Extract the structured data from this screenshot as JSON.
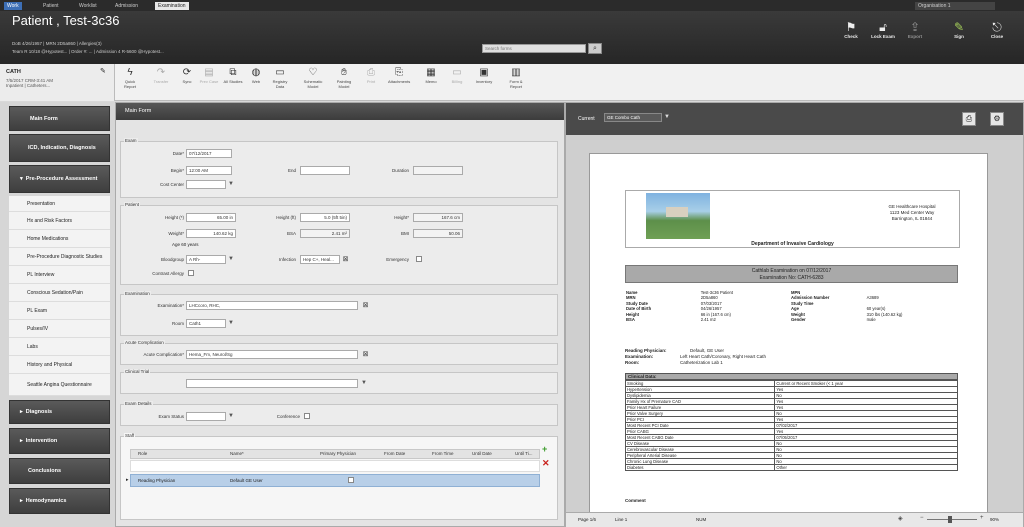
{
  "tabs": [
    "Work",
    "Patient",
    "Worklist",
    "Admission",
    "Examination"
  ],
  "topbar_right": "Organisation 1",
  "patient": {
    "name": "Patient , Test-3c36",
    "line1": "DoB 4/26/1957 | MRN 2D5a860 | Allergies(3)",
    "line2": "Team R 10/18 @Hypotest... | Order #: ... | Admission 4 R-5600 @Hypotest...",
    "allergy_label": "Allergies(3)"
  },
  "search": {
    "placeholder": "Search forms"
  },
  "header_buttons": [
    {
      "icon": "flag-icon",
      "label": "Check"
    },
    {
      "icon": "lock-icon",
      "label": "Lock Exam"
    },
    {
      "icon": "export-icon",
      "label": "Export"
    },
    {
      "icon": "pen-icon",
      "label": "Sign"
    },
    {
      "icon": "close-icon",
      "label": "Close"
    }
  ],
  "cath": {
    "title": "CATH",
    "line1": "7/5/2017 CRM-3:41 AM",
    "line2": "Inpatient | Catheters..."
  },
  "toolbar": [
    {
      "icon": "lightning-icon",
      "label": "Quick Report",
      "disabled": false
    },
    {
      "icon": "forward-icon",
      "label": "Transfer",
      "disabled": true
    },
    {
      "icon": "sync-icon",
      "label": "Sync",
      "disabled": false
    },
    {
      "icon": "preview-icon",
      "label": "Prev Case",
      "disabled": true
    },
    {
      "icon": "studies-icon",
      "label": "All Studies",
      "disabled": false
    },
    {
      "icon": "web-icon",
      "label": "Web",
      "disabled": false
    },
    {
      "icon": "registry-icon",
      "label": "Registry Data",
      "disabled": false
    },
    {
      "icon": "heart-icon",
      "label": "Schematic Model",
      "disabled": false
    },
    {
      "icon": "hand-icon",
      "label": "Painting Model",
      "disabled": false
    },
    {
      "icon": "print-icon",
      "label": "Print",
      "disabled": true
    },
    {
      "icon": "attachment-icon",
      "label": "Attachments",
      "disabled": false
    },
    {
      "icon": "memo-icon",
      "label": "Memo",
      "disabled": false
    },
    {
      "icon": "billing-icon",
      "label": "Billing",
      "disabled": true
    },
    {
      "icon": "inventory-icon",
      "label": "Inventory",
      "disabled": false
    },
    {
      "icon": "report-icon",
      "label": "Form & Report",
      "disabled": false
    }
  ],
  "sidebar": {
    "main_form": "Main Form",
    "icd": "ICD, Indication, Diagnosis",
    "pre": "Pre-Procedure Assessment",
    "sub": [
      "Presentation",
      "Hx and Risk Factors",
      "Home Medications",
      "Pre-Procedure Diagnostic Studies",
      "PL Interview",
      "Conscious Sedation/Pain",
      "PL Exam",
      "Pulses/IV",
      "Labs",
      "History and Physical",
      "Seattle Angina Questionnaire"
    ],
    "diagnosis": "Diagnosis",
    "intervention": "Intervention",
    "conclusions": "Conclusions",
    "hemodynamics": "Hemodynamics"
  },
  "main": {
    "title": "Main Form",
    "exam": {
      "legend": "Exam",
      "date_label": "Date*",
      "date": "07/12/2017",
      "begin_label": "Begin*",
      "begin": "12:00 AM",
      "end_label": "End",
      "duration_label": "Duration",
      "cost_label": "Cost Center"
    },
    "patient": {
      "legend": "Patient",
      "height_cm_label": "Height (*)",
      "height_cm": "65.00 in",
      "height_ft_label": "Height (ft)",
      "height_ft": "5.0 (5ft 5in)",
      "height_label": "Height*",
      "height": "167.6 cm",
      "weight_label": "Weight*",
      "weight": "140.62 kg",
      "bsa_label": "BSA",
      "bsa": "2.41 m²",
      "bmi_label": "BMI",
      "bmi": "50.06",
      "age": "Age 60 years",
      "blood_label": "Bloodgroup",
      "blood": "A Rh-",
      "infection_label": "Infection",
      "infection": "Hep C+, Heal...",
      "emergency_label": "Emergency",
      "contrast_label": "Contrast Allergy"
    },
    "examination": {
      "legend": "Examination",
      "exam_label": "Examination*",
      "exam": "LHCcoro, RHC,",
      "room_label": "Room",
      "room": "Cath1"
    },
    "acute": {
      "legend": "Acute Complication",
      "label": "Acute Complication*",
      "value": "Hema_Fm, Neurol/Sg"
    },
    "clinical": {
      "legend": "Clinical Trial"
    },
    "details": {
      "legend": "Exam Details",
      "status_label": "Exam Status",
      "conference_label": "Conference"
    },
    "staff": {
      "legend": "Staff",
      "cols": [
        "Role",
        "Name*",
        "Primary Physician",
        "From Date",
        "From Time",
        "Until Date",
        "Until Ti..."
      ],
      "row": {
        "role": "Reading Physician",
        "name": "Default GE User"
      }
    }
  },
  "viewer": {
    "current_label": "Current",
    "current_value": "GE Combo Cath",
    "page": "Page 1/6",
    "line": "Line 1",
    "num": "NUM",
    "zoom": "90%"
  },
  "report": {
    "hospital": [
      "GE Healthcare Hospital",
      "1123 Med Center Way",
      "Barrington, IL 01844"
    ],
    "department": "Department of Invasive Cardiology",
    "banner1": "Cathlab Examination on 07/12/2017",
    "banner2": "Examination No: CATH-6283",
    "left_rows": [
      [
        "Name",
        "Test-3c36 Patient"
      ],
      [
        "MRN",
        "2D5a860"
      ],
      [
        "Study Date",
        "07/03/2017"
      ],
      [
        "Date of Birth",
        "04/26/1957"
      ],
      [
        "Height",
        "66 in  (167.6 cm)"
      ],
      [
        "BSA",
        "2.41 m2"
      ]
    ],
    "right_rows": [
      [
        "MPN",
        ""
      ],
      [
        "Admission Number",
        "A3689"
      ],
      [
        "Study Time",
        ""
      ],
      [
        "Age",
        "60 year(s)"
      ],
      [
        "Weight",
        "310 lbs  (140.62 kg)"
      ],
      [
        "Gender",
        "male"
      ]
    ],
    "reading_label": "Reading Physician:",
    "reading": "Default, GE User",
    "exam_label": "Examination:",
    "exam": "Left Heart Cath/Coronary, Right Heart Cath",
    "room_label": "Room:",
    "room": "Catheterization Lab 1",
    "clinical_header": "Clinical Data:",
    "clinical": [
      [
        "Smoking",
        "Current or Recent Smoker (< 1 year"
      ],
      [
        "Hypertension",
        "Yes"
      ],
      [
        "Dyslipidemia",
        "No"
      ],
      [
        "Family Hx of Premature CAD",
        "Yes"
      ],
      [
        "Prior Heart Failure",
        "Yes"
      ],
      [
        "Prior Valve Surgery",
        "No"
      ],
      [
        "Prior PCI",
        "Yes"
      ],
      [
        "Most Recent PCI Date",
        "07/02/2017"
      ],
      [
        "Prior CABG",
        "Yes"
      ],
      [
        "Most Recent CABG Date",
        "07/05/2017"
      ],
      [
        "CV Disease",
        "No"
      ],
      [
        "Cerebrovascular Disease",
        "No"
      ],
      [
        "Peripheral Arterial Disease",
        "No"
      ],
      [
        "Chronic Lung Disease",
        "No"
      ],
      [
        "Diabetes",
        "Other"
      ]
    ],
    "comment": "Comment"
  }
}
